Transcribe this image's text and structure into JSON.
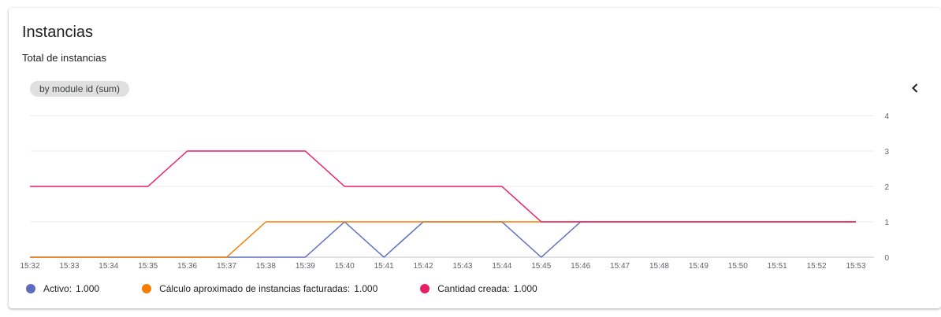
{
  "header": {
    "title": "Instancias",
    "subtitle": "Total de instancias",
    "chip_label": "by module id (sum)"
  },
  "icons": {
    "collapse": "chevron-left-icon"
  },
  "colors": {
    "activo": "#5c6bc0",
    "calculo": "#f57c00",
    "cantidad": "#e91e63",
    "grid": "#e8eaed",
    "axis": "#dadce0"
  },
  "legend": [
    {
      "name": "Activo",
      "value": "1.000",
      "color": "#5c6bc0"
    },
    {
      "name": "Cálculo aproximado de instancias facturadas",
      "value": "1.000",
      "color": "#f57c00"
    },
    {
      "name": "Cantidad creada",
      "value": "1.000",
      "color": "#e91e63"
    }
  ],
  "chart_data": {
    "type": "line",
    "x": [
      "15:32",
      "15:33",
      "15:34",
      "15:35",
      "15:36",
      "15:37",
      "15:38",
      "15:39",
      "15:40",
      "15:41",
      "15:42",
      "15:43",
      "15:44",
      "15:45",
      "15:46",
      "15:47",
      "15:48",
      "15:49",
      "15:50",
      "15:51",
      "15:52",
      "15:53"
    ],
    "ylim": [
      0,
      4
    ],
    "yticks": [
      "0",
      "1",
      "2",
      "3",
      "4"
    ],
    "y_axis_side": "right",
    "grid": true,
    "legend_position": "bottom",
    "series": [
      {
        "name": "Activo",
        "color": "#5c6bc0",
        "values": [
          0,
          0,
          0,
          0,
          0,
          0,
          0,
          0,
          1,
          0,
          1,
          1,
          1,
          0,
          1,
          1,
          1,
          1,
          1,
          1,
          1,
          1
        ]
      },
      {
        "name": "Cálculo aproximado de instancias facturadas",
        "color": "#f57c00",
        "values": [
          0,
          0,
          0,
          0,
          0,
          0,
          1,
          1,
          1,
          1,
          1,
          1,
          1,
          1,
          1,
          1,
          1,
          1,
          1,
          1,
          1,
          1
        ]
      },
      {
        "name": "Cantidad creada",
        "color": "#e91e63",
        "values": [
          2,
          2,
          2,
          2,
          3,
          3,
          3,
          3,
          2,
          2,
          2,
          2,
          2,
          1,
          1,
          1,
          1,
          1,
          1,
          1,
          1,
          1
        ]
      }
    ]
  }
}
